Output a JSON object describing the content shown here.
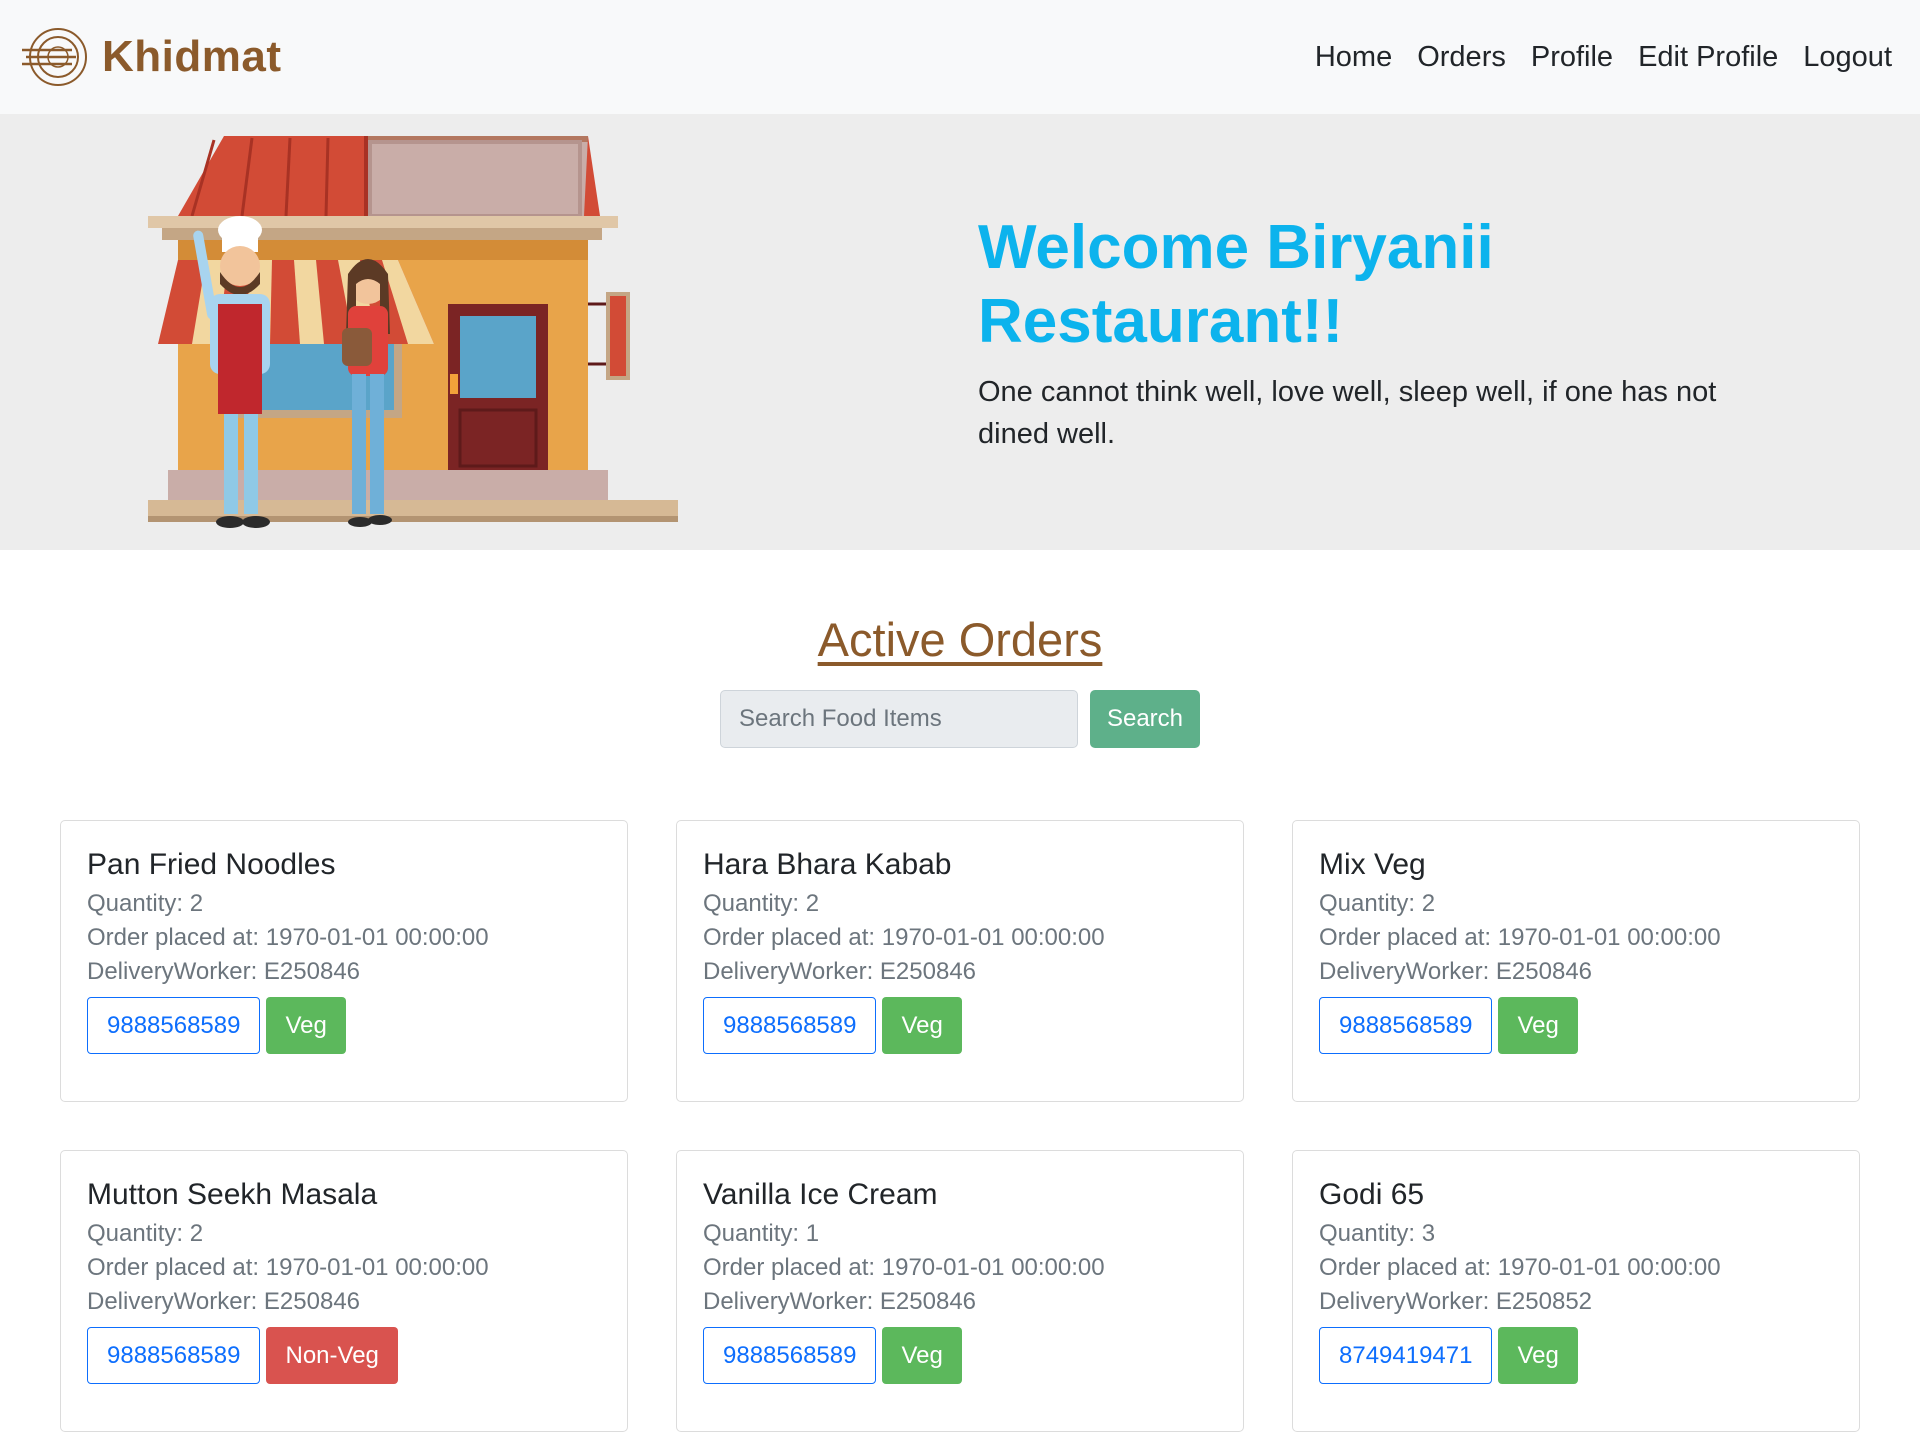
{
  "navbar": {
    "brand": "Khidmat",
    "links": [
      "Home",
      "Orders",
      "Profile",
      "Edit Profile",
      "Logout"
    ]
  },
  "hero": {
    "title": "Welcome Biryanii Restaurant!!",
    "quote": "One cannot think well, love well, sleep well, if one has not dined well."
  },
  "orders": {
    "title": "Active Orders",
    "search_placeholder": "Search Food Items",
    "search_button": "Search",
    "items": [
      {
        "name": "Pan Fried Noodles",
        "quantity": "Quantity: 2",
        "placed": "Order placed at: 1970-01-01 00:00:00",
        "worker": "DeliveryWorker: E250846",
        "phone": "9888568589",
        "type": "Veg"
      },
      {
        "name": "Hara Bhara Kabab",
        "quantity": "Quantity: 2",
        "placed": "Order placed at: 1970-01-01 00:00:00",
        "worker": "DeliveryWorker: E250846",
        "phone": "9888568589",
        "type": "Veg"
      },
      {
        "name": "Mix Veg",
        "quantity": "Quantity: 2",
        "placed": "Order placed at: 1970-01-01 00:00:00",
        "worker": "DeliveryWorker: E250846",
        "phone": "9888568589",
        "type": "Veg"
      },
      {
        "name": "Mutton Seekh Masala",
        "quantity": "Quantity: 2",
        "placed": "Order placed at: 1970-01-01 00:00:00",
        "worker": "DeliveryWorker: E250846",
        "phone": "9888568589",
        "type": "Non-Veg"
      },
      {
        "name": "Vanilla Ice Cream",
        "quantity": "Quantity: 1",
        "placed": "Order placed at: 1970-01-01 00:00:00",
        "worker": "DeliveryWorker: E250846",
        "phone": "9888568589",
        "type": "Veg"
      },
      {
        "name": "Godi 65",
        "quantity": "Quantity: 3",
        "placed": "Order placed at: 1970-01-01 00:00:00",
        "worker": "DeliveryWorker: E250852",
        "phone": "8749419471",
        "type": "Veg"
      }
    ]
  },
  "colors": {
    "brand": "#8b5a2b",
    "hero_title": "#0cb3ed",
    "veg": "#5cb85c",
    "nonveg": "#d9534f",
    "search": "#5eb08a",
    "phone": "#0d6efd"
  }
}
